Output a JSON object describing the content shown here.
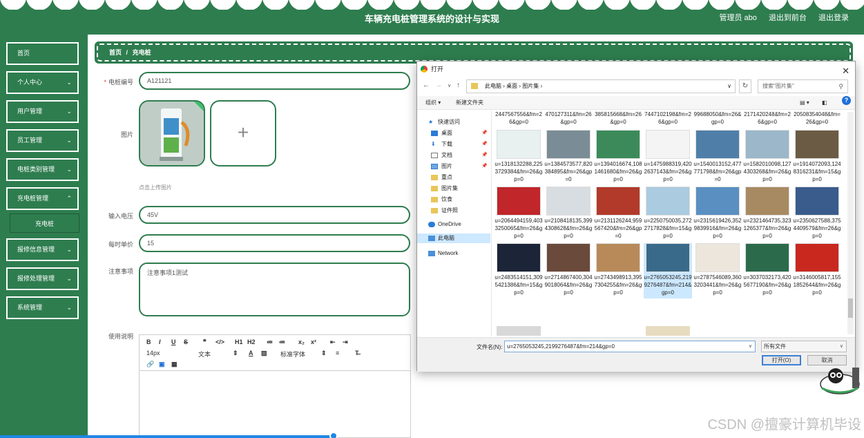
{
  "header": {
    "title": "车辆充电桩管理系统的设计与实现",
    "admin": "管理员 abo",
    "to_front": "退出到前台",
    "logout": "退出登录"
  },
  "sidebar": {
    "items": [
      {
        "label": "首页"
      },
      {
        "label": "个人中心"
      },
      {
        "label": "用户管理"
      },
      {
        "label": "员工管理"
      },
      {
        "label": "电桩类别管理"
      },
      {
        "label": "充电桩管理"
      },
      {
        "label": "报修信息管理"
      },
      {
        "label": "报修处理管理"
      },
      {
        "label": "系统管理"
      }
    ],
    "submenu": "充电桩"
  },
  "breadcrumb": {
    "home": "首页",
    "sep": "/",
    "current": "充电桩"
  },
  "form": {
    "code_label": "电桩编号",
    "code_value": "A121121",
    "image_label": "图片",
    "upload_hint": "点击上传图片",
    "voltage_label": "输入电压",
    "voltage_value": "45V",
    "price_label": "每时单价",
    "price_value": "15",
    "notes_label": "注意事项",
    "notes_value": "注意事项1测试",
    "usage_label": "使用说明"
  },
  "editor": {
    "row1": [
      "B",
      "I",
      "U",
      "S",
      "❞",
      "</>",
      "H1",
      "H2",
      "≔",
      "≔",
      "x₂",
      "x²",
      "⇤",
      "⇥"
    ],
    "font_size": "14px",
    "text_type": "文本",
    "font_family": "标准字体"
  },
  "dialog": {
    "title": "打开",
    "path": [
      "此电脑",
      "桌面",
      "图片集"
    ],
    "search_placeholder": "搜索\"图片集\"",
    "organize": "组织 ▾",
    "new_folder": "新建文件夹",
    "nav": [
      {
        "label": "快速访问"
      },
      {
        "label": "桌面"
      },
      {
        "label": "下载"
      },
      {
        "label": "文档"
      },
      {
        "label": "图片"
      },
      {
        "label": "重点"
      },
      {
        "label": "图片集"
      },
      {
        "label": "饮食"
      },
      {
        "label": "证件照"
      },
      {
        "label": "OneDrive"
      },
      {
        "label": "此电脑"
      },
      {
        "label": "Network"
      }
    ],
    "top_row": [
      "2447567556&fm=26&gp=0",
      "470127311&fm=26&gp=0",
      "385815668&fm=26&gp=0",
      "7447102198&fm=26&gp=0",
      "99688050&fm=26&gp=0",
      "2171420248&fm=26&gp=0",
      "20508354048&fm=26&gp=0"
    ],
    "files": [
      {
        "name": "u=1318132288,2253729384&fm=26&gp=0",
        "color": "#e8f0f0"
      },
      {
        "name": "u=1384573577,820384895&fm=26&gp=0",
        "color": "#7a8c96"
      },
      {
        "name": "u=1394016674,1081461680&fm=26&gp=0",
        "color": "#3c8a5a"
      },
      {
        "name": "u=1475988319,4202637143&fm=26&gp=0",
        "color": "#f4f4f4"
      },
      {
        "name": "u=1540013152,477771798&fm=26&gp=0",
        "color": "#4f7fa8"
      },
      {
        "name": "u=1582010098,1274303268&fm=26&gp=0",
        "color": "#9bb7c9"
      },
      {
        "name": "u=1914072093,1248316231&fm=15&gp=0",
        "color": "#6b5b45"
      },
      {
        "name": "u=2064494159,4033250065&fm=26&gp=0",
        "color": "#c0262a"
      },
      {
        "name": "u=2108418135,3994308628&fm=26&gp=0",
        "color": "#d8dde2"
      },
      {
        "name": "u=2131126244,959567420&fm=26&gp=0",
        "color": "#b23a2a"
      },
      {
        "name": "u=2250750035,2722717828&fm=15&gp=0",
        "color": "#aacbe0"
      },
      {
        "name": "u=2315619426,3529839916&fm=26&gp=0",
        "color": "#5a8fc2"
      },
      {
        "name": "u=2321464735,3231265377&fm=26&gp=0",
        "color": "#a88a62"
      },
      {
        "name": "u=2350627588,3754409579&fm=26&gp=0",
        "color": "#3a5c8c"
      },
      {
        "name": "u=2483514151,3095421386&fm=15&gp=0",
        "color": "#1c2438"
      },
      {
        "name": "u=2714867400,3049018064&fm=26&gp=0",
        "color": "#6a4a3a"
      },
      {
        "name": "u=2743498913,3957304255&fm=26&gp=0",
        "color": "#b88a5a"
      },
      {
        "name": "u=2765053245,2199276487&fm=214&gp=0",
        "color": "#3a6a8a"
      },
      {
        "name": "u=2787546089,3603203441&fm=26&gp=0",
        "color": "#ece6dc"
      },
      {
        "name": "u=3037032173,4205677190&fm=26&gp=0",
        "color": "#2c6a4c"
      },
      {
        "name": "u=3146005817,1551852644&fm=26&gp=0",
        "color": "#c8281e"
      }
    ],
    "selected": "u=2765053245,2199276487&fm=214&gp=0",
    "filename_label": "文件名(N):",
    "filename_value": "u=2765053245,2199276487&fm=214&gp=0",
    "filetype": "所有文件",
    "open_btn": "打开(O)",
    "cancel_btn": "取消"
  },
  "watermark": "CSDN @擅豪计算机毕设"
}
